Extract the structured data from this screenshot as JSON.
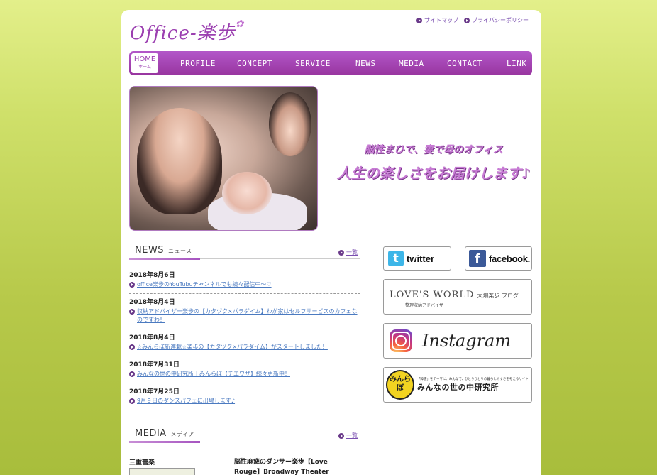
{
  "logo": {
    "text": "Office-楽歩",
    "flower": "✿"
  },
  "toplinks": [
    {
      "label": "サイトマップ"
    },
    {
      "label": "プライバシーポリシー"
    }
  ],
  "nav": {
    "home_en": "HOME",
    "home_jp": "ホーム",
    "items": [
      "PROFILE",
      "CONCEPT",
      "SERVICE",
      "NEWS",
      "MEDIA",
      "CONTACT",
      "LINK"
    ]
  },
  "tagline": {
    "line1": "脳性まひで、妻で母のオフィス",
    "line2": "人生の楽しさをお届けします♪"
  },
  "news": {
    "title_en": "NEWS",
    "title_jp": "ニュース",
    "more": "一覧",
    "items": [
      {
        "date": "2018年8月6日",
        "text": "office楽歩のYouTubuチャンネルでも続々配信中〜♡"
      },
      {
        "date": "2018年8月4日",
        "text": "収納アドバイザー楽歩の【カタヅク×パラダイム】わが家はセルフサービスのカフェなのですわ！"
      },
      {
        "date": "2018年8月4日",
        "text": "☆みんらぼ新連載☆楽歩の【カタヅク×パラダイム】がスタートしました！"
      },
      {
        "date": "2018年7月31日",
        "text": "みんなの世の中研究所｜みんらぼ【チエワザ】続々更新中！"
      },
      {
        "date": "2018年7月25日",
        "text": "9月９日のダンスパフェに出場します♪"
      }
    ]
  },
  "media": {
    "title_en": "MEDIA",
    "title_jp": "メディア",
    "more": "一覧",
    "item1": "三重蕾楽",
    "item2": "脳性麻痺のダンサー楽歩【Love Rouge】Broadway Theater"
  },
  "banners": {
    "twitter": {
      "icon": "t",
      "label": "twitter"
    },
    "facebook": {
      "icon": "f",
      "label": "facebook."
    },
    "loves_world": {
      "title": "LOVE'S WORLD",
      "sub_title": "大畑楽歩 ブログ",
      "caption": "整理収納アドバイザー"
    },
    "instagram": {
      "label": "Instagram"
    },
    "minlabo": {
      "icon": "みんらぼ",
      "sub": "「障害」をテーマに、みんなで、ひとりひとりの暮らしやすさを考えるサイト",
      "main": "みんなの世の中研究所"
    }
  }
}
